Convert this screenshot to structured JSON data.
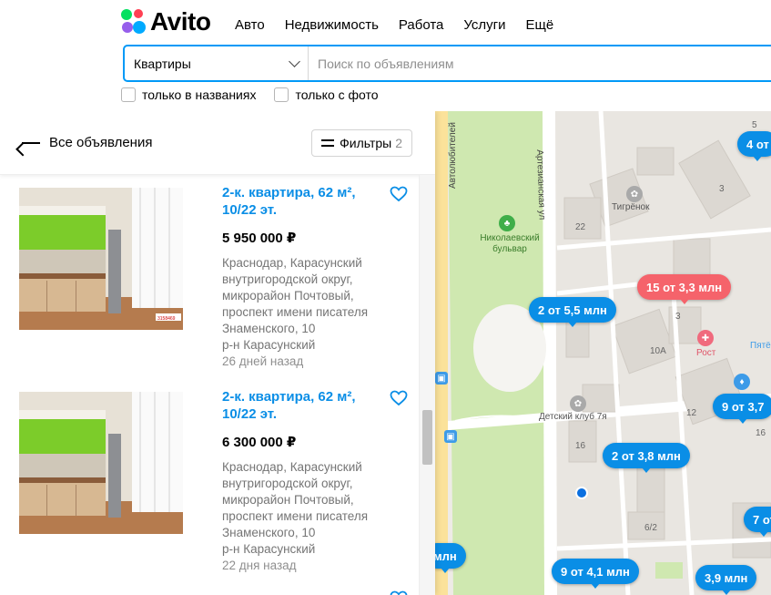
{
  "header": {
    "logo_text": "Avito",
    "nav": [
      "Авто",
      "Недвижимость",
      "Работа",
      "Услуги",
      "Ещё"
    ],
    "search": {
      "category": "Квартиры",
      "placeholder": "Поиск по объявлениям"
    },
    "checkboxes": [
      {
        "label": "только в названиях",
        "checked": false
      },
      {
        "label": "только с фото",
        "checked": false
      }
    ]
  },
  "panel": {
    "back_label": "Все объявления",
    "filters_label": "Фильтры",
    "filters_count": "2",
    "listings": [
      {
        "title": "2-к. квартира, 62 м², 10/22 эт.",
        "price": "5 950 000 ₽",
        "address": "Краснодар, Карасунский внутригородской округ, микрорайон Почтовый, проспект имени писателя Знаменского, 10",
        "district": "р-н Карасунский",
        "date": "26 дней назад",
        "photo_watermark": "3158469",
        "favorite": false
      },
      {
        "title": "2-к. квартира, 62 м², 10/22 эт.",
        "price": "6 300 000 ₽",
        "address": "Краснодар, Карасунский внутригородской округ, микрорайон Почтовый, проспект имени писателя Знаменского, 10",
        "district": "р-н Карасунский",
        "date": "22 дня назад",
        "favorite": false
      }
    ]
  },
  "map": {
    "streets": [
      "Артезианская ул",
      "Автолюбителей"
    ],
    "places": [
      "Николаевский бульвар",
      "Тигрёнок",
      "Детский клуб 7я",
      "Рост",
      "Пятё"
    ],
    "house_numbers": [
      "5",
      "3",
      "22",
      "10А",
      "12",
      "16",
      "16",
      "6/2",
      "3"
    ],
    "pins": [
      {
        "label": "4 от",
        "type": "blue"
      },
      {
        "label": "15 от 3,3 млн",
        "type": "red"
      },
      {
        "label": "2 от 5,5 млн",
        "type": "blue"
      },
      {
        "label": "9 от 3,7",
        "type": "blue"
      },
      {
        "label": "2 от 3,8 млн",
        "type": "blue"
      },
      {
        "label": "7 от",
        "type": "blue"
      },
      {
        "label": "9 от 4,1 млн",
        "type": "blue"
      },
      {
        "label": "3,9 млн",
        "type": "blue"
      },
      {
        "label": "млн",
        "type": "blue"
      }
    ],
    "colors": {
      "pin_blue": "#0a8ee6",
      "pin_red": "#f5636b",
      "park": "#cfe8b0"
    }
  }
}
